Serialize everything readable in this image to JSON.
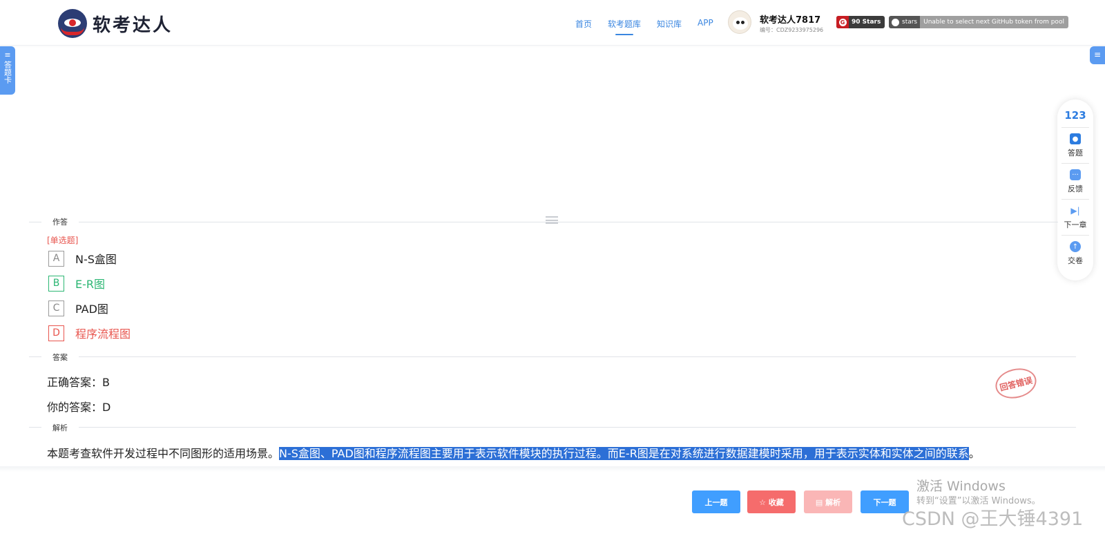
{
  "header": {
    "brand": "软考达人",
    "nav": [
      "首页",
      "软考题库",
      "知识库",
      "APP"
    ],
    "active_nav": "软考题库",
    "user": {
      "name": "软考达人7817",
      "id": "编号：CDZ9233975296"
    },
    "badges": {
      "gitee_stars": "90 Stars",
      "github_label": "stars",
      "github_message": "Unable to select next GitHub token from pool"
    }
  },
  "side": {
    "left_tab": "答题卡",
    "menu_icon": "≡"
  },
  "toolbar": {
    "count": "123",
    "items": [
      "答题",
      "反馈",
      "下一章",
      "交卷"
    ]
  },
  "sections": {
    "answer_area": "作答",
    "answer": "答案",
    "analysis": "解析"
  },
  "question": {
    "type": "[单选题]",
    "options": [
      {
        "letter": "A",
        "text": "N-S盒图",
        "state": "normal"
      },
      {
        "letter": "B",
        "text": "E-R图",
        "state": "correct"
      },
      {
        "letter": "C",
        "text": "PAD图",
        "state": "normal"
      },
      {
        "letter": "D",
        "text": "程序流程图",
        "state": "wrong"
      }
    ],
    "correct_answer": "正确答案：B",
    "your_answer": "你的答案：D",
    "result_stamp": "回答错误",
    "analysis_prefix": "本题考查软件开发过程中不同图形的适用场景。",
    "analysis_highlight": "N-S盒图、PAD图和程序流程图主要用于表示软件模块的执行过程。而E-R图是在对系统进行数据建模时采用，用于表示实体和实体之间的联系",
    "analysis_suffix": "。"
  },
  "bottom_buttons": {
    "prev": "上一题",
    "fav": "☆ 收藏",
    "analysis": "▤ 解析",
    "next": "下一题"
  },
  "watermarks": {
    "windows_title": "激活 Windows",
    "windows_sub": "转到“设置”以激活 Windows。",
    "csdn": "CSDN @王大锤4391"
  },
  "colors": {
    "accent": "#409eff",
    "correct": "#2bb673",
    "wrong": "#e8554e",
    "highlight": "#2c6fd6"
  }
}
